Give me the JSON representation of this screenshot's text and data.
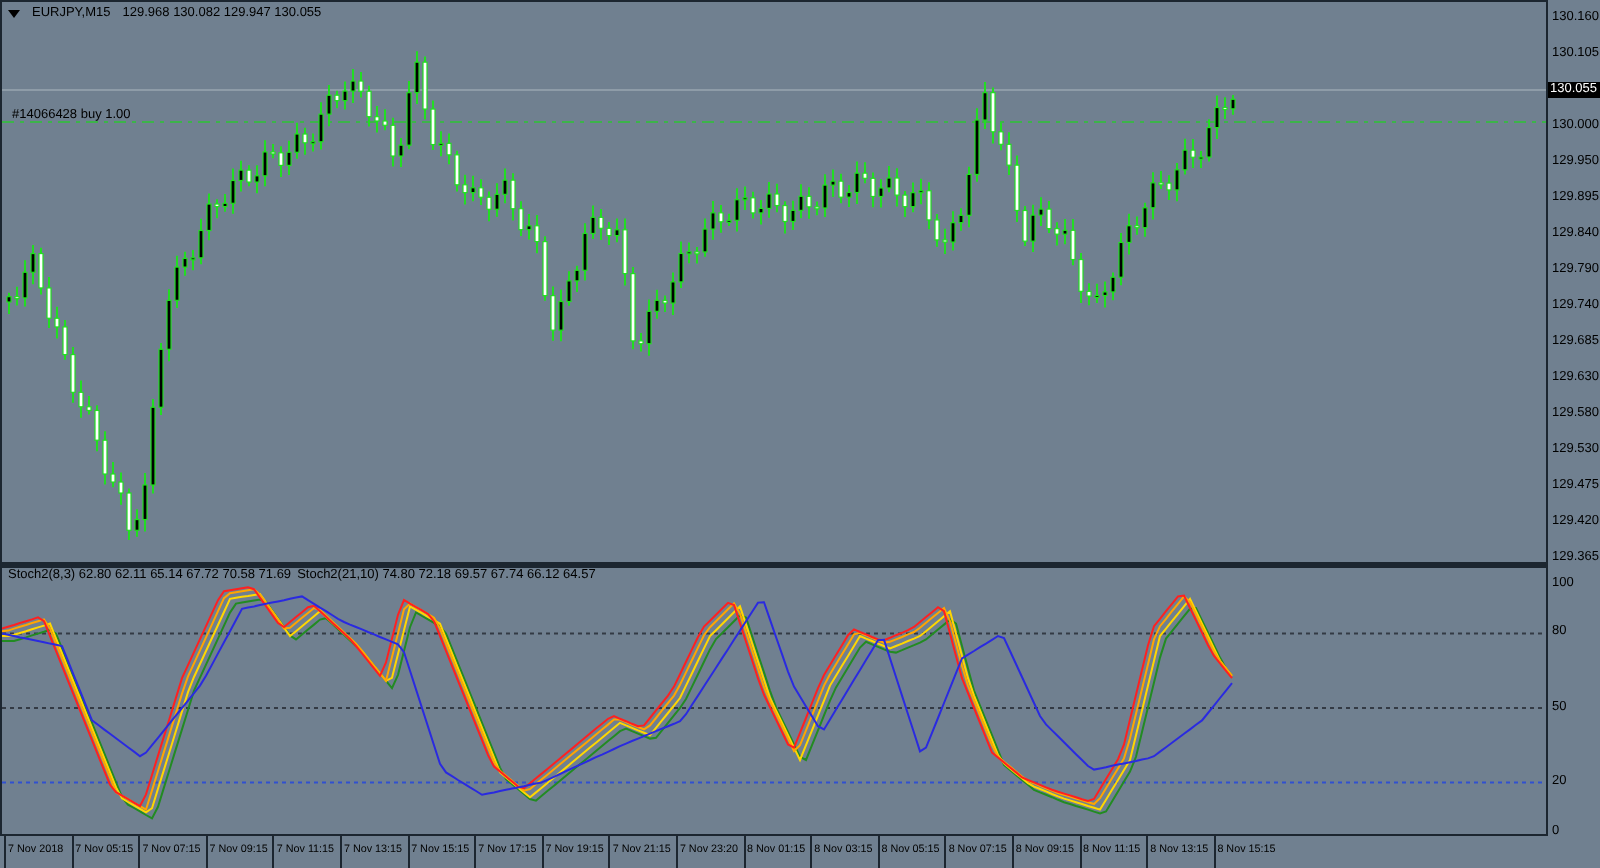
{
  "header": {
    "symbol": "EURJPY,M15",
    "prices": "129.968 130.082 129.947 130.055"
  },
  "order": {
    "label": "#14066428 buy 1.00"
  },
  "price_axis": [
    {
      "label": "130.160",
      "kind": "tick"
    },
    {
      "label": "130.105",
      "kind": "tick"
    },
    {
      "label": "130.055",
      "kind": "current"
    },
    {
      "label": "130.000",
      "kind": "tick"
    },
    {
      "label": "129.950",
      "kind": "tick"
    },
    {
      "label": "129.895",
      "kind": "tick"
    },
    {
      "label": "129.840",
      "kind": "tick"
    },
    {
      "label": "129.790",
      "kind": "tick"
    },
    {
      "label": "129.740",
      "kind": "tick"
    },
    {
      "label": "129.685",
      "kind": "tick"
    },
    {
      "label": "129.630",
      "kind": "tick"
    },
    {
      "label": "129.580",
      "kind": "tick"
    },
    {
      "label": "129.530",
      "kind": "tick"
    },
    {
      "label": "129.475",
      "kind": "tick"
    },
    {
      "label": "129.420",
      "kind": "tick"
    },
    {
      "label": "129.365",
      "kind": "tick"
    }
  ],
  "indicator": {
    "labels": [
      "Stoch2(8,3) 62.80 62.11 65.14 67.72 70.58 71.69",
      "Stoch2(21,10) 74.80 72.18 69.57 67.74 66.12 64.57"
    ],
    "levels": [
      {
        "label": "100"
      },
      {
        "label": "80"
      },
      {
        "label": "50"
      },
      {
        "label": "20"
      },
      {
        "label": "0"
      }
    ]
  },
  "time_axis": [
    "7 Nov 2018",
    "7 Nov 05:15",
    "7 Nov 07:15",
    "7 Nov 09:15",
    "7 Nov 11:15",
    "7 Nov 13:15",
    "7 Nov 15:15",
    "7 Nov 17:15",
    "7 Nov 19:15",
    "7 Nov 21:15",
    "7 Nov 23:20",
    "8 Nov 01:15",
    "8 Nov 03:15",
    "8 Nov 05:15",
    "8 Nov 07:15",
    "8 Nov 09:15",
    "8 Nov 11:15",
    "8 Nov 13:15",
    "8 Nov 15:15"
  ]
}
